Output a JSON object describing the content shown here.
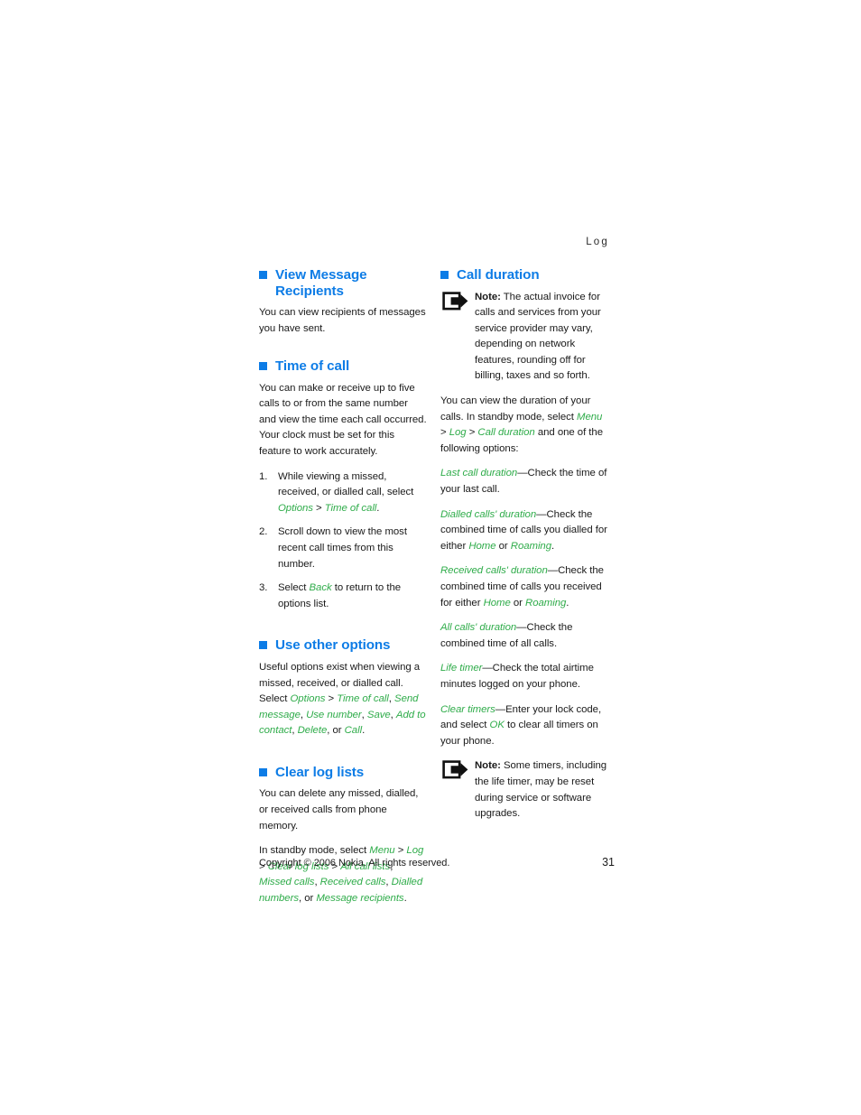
{
  "header": {
    "running_head": "Log"
  },
  "colors": {
    "heading_blue": "#0d7ce6",
    "gui_green": "#2fac4a",
    "body_text": "#1a1a1a"
  },
  "left_column": {
    "sections": [
      {
        "id": "view-message-recipients",
        "heading": "View Message Recipients",
        "paragraphs": [
          "You can view recipients of messages you have sent."
        ]
      },
      {
        "id": "time-of-call",
        "heading": "Time of call",
        "paragraphs": [
          "You can make or receive up to five calls to or from the same number and view the time each call occurred. Your clock must be set for this feature to work accurately."
        ],
        "steps": [
          {
            "num": "1.",
            "pre": "While viewing a missed, received, or dialled call, select ",
            "gui1": "Options",
            "mid": " > ",
            "gui2": "Time of call",
            "post": "."
          },
          {
            "num": "2.",
            "pre": "Scroll down to view the most recent call times from this number.",
            "gui1": "",
            "mid": "",
            "gui2": "",
            "post": ""
          },
          {
            "num": "3.",
            "pre": "Select ",
            "gui1": "Back",
            "mid": " to return to the options list.",
            "gui2": "",
            "post": ""
          }
        ]
      },
      {
        "id": "use-other-options",
        "heading": "Use other options",
        "intro": "Useful options exist when viewing a missed, received, or dialled call. Select ",
        "option_path": [
          "Options",
          "Time of call",
          "Send message",
          "Use number",
          "Save",
          "Add to contact",
          "Delete",
          "Call"
        ]
      },
      {
        "id": "clear-log-lists",
        "heading": "Clear log lists",
        "paragraphs": [
          "You can delete any missed, dialled, or received calls from phone memory."
        ],
        "intro": "In standby mode, select ",
        "path_items": [
          "Menu",
          "Log",
          "Clear log lists",
          "All call lists",
          "Missed calls",
          "Received calls",
          "Dialled numbers",
          "Message recipients"
        ]
      }
    ]
  },
  "right_column": {
    "heading": "Call duration",
    "note_1": {
      "icon": "note-arrow-icon",
      "label": "Note:",
      "text": " The actual invoice for calls and services from your service provider may vary, depending on network features, rounding off for billing, taxes and so forth."
    },
    "intro": {
      "pre": "You can view the duration of your calls. In standby mode, select ",
      "gui_menu": "Menu",
      "sep1": " > ",
      "gui_log": "Log",
      "sep2": " > ",
      "gui_callduration": "Call duration",
      "post": " and one of the following options:"
    },
    "options": [
      {
        "term": "Last call duration",
        "desc_pre": "—Check the time of your last call.",
        "desc_gui1": "",
        "desc_mid": "",
        "desc_gui2": "",
        "desc_post": ""
      },
      {
        "term": "Dialled calls' duration",
        "desc_pre": "—Check the combined time of calls you dialled for either ",
        "desc_gui1": "Home",
        "desc_mid": " or ",
        "desc_gui2": "Roaming",
        "desc_post": "."
      },
      {
        "term": "Received calls' duration",
        "desc_pre": "—Check the combined time of calls you received for either ",
        "desc_gui1": "Home",
        "desc_mid": " or ",
        "desc_gui2": "Roaming",
        "desc_post": "."
      },
      {
        "term": "All calls' duration",
        "desc_pre": "—Check the combined time of all calls.",
        "desc_gui1": "",
        "desc_mid": "",
        "desc_gui2": "",
        "desc_post": ""
      },
      {
        "term": "Life timer",
        "desc_pre": "—Check the total airtime minutes logged on your phone.",
        "desc_gui1": "",
        "desc_mid": "",
        "desc_gui2": "",
        "desc_post": ""
      },
      {
        "term": "Clear timers",
        "desc_pre": "—Enter your lock code, and select ",
        "desc_gui1": "OK",
        "desc_mid": " to clear all timers on your phone.",
        "desc_gui2": "",
        "desc_post": ""
      }
    ],
    "note_2": {
      "icon": "note-arrow-icon",
      "label": "Note:",
      "text": " Some timers, including the life timer, may be reset during service or software upgrades."
    }
  },
  "footer": {
    "copyright": "Copyright © 2006 Nokia. All rights reserved.",
    "page_number": "31"
  }
}
